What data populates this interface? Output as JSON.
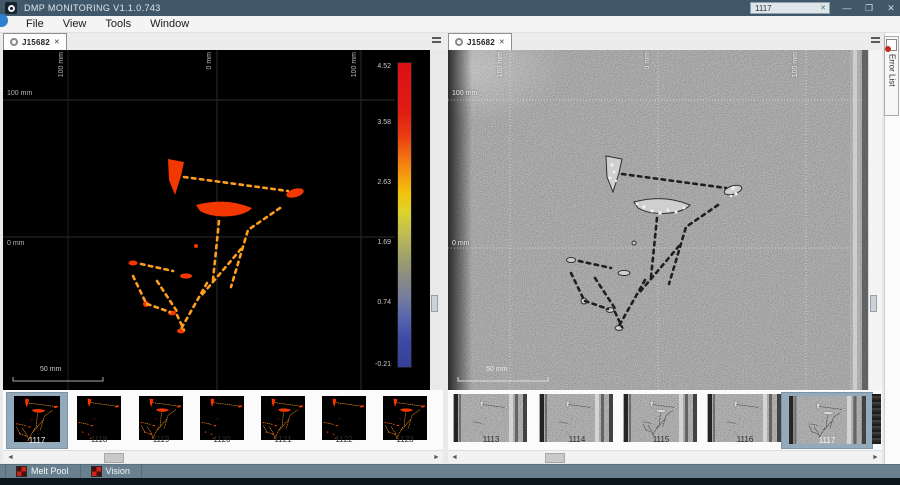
{
  "titlebar": {
    "title": "DMP MONITORING V1.1.0.743",
    "search_value": "1117"
  },
  "icons": {
    "minimize": "—",
    "restore": "❐",
    "close": "✕",
    "clear": "✕",
    "tab_close": "✕",
    "arrow_left": "◄",
    "arrow_right": "►"
  },
  "menubar": {
    "items": [
      "File",
      "View",
      "Tools",
      "Window"
    ]
  },
  "melt_pool_panel": {
    "tab_label": "J15682",
    "axis_top": [
      "100 mm",
      "0 mm",
      "100 mm"
    ],
    "axis_left_top": "100 mm",
    "axis_left_mid": "0 mm",
    "scale_label": "50 mm",
    "colorbar": {
      "labels": [
        "4.52",
        "3.58",
        "2.63",
        "1.69",
        "0.74",
        "-0.21"
      ]
    },
    "thumbnails": [
      {
        "label": "1117",
        "selected": true
      },
      {
        "label": "1118",
        "selected": false
      },
      {
        "label": "1119",
        "selected": false
      },
      {
        "label": "1120",
        "selected": false
      },
      {
        "label": "1121",
        "selected": false
      },
      {
        "label": "1122",
        "selected": false
      },
      {
        "label": "1123",
        "selected": false
      }
    ]
  },
  "vision_panel": {
    "tab_label": "J15682",
    "axis_top": [
      "100 mm",
      "0 mm",
      "100 mm"
    ],
    "axis_left_top": "100 mm",
    "axis_left_mid": "0 mm",
    "scale_label": "50 mm",
    "thumbnails": [
      {
        "label": "1113",
        "selected": false
      },
      {
        "label": "1114",
        "selected": false
      },
      {
        "label": "1115",
        "selected": false
      },
      {
        "label": "1116",
        "selected": false
      },
      {
        "label": "1117",
        "selected": true
      }
    ]
  },
  "error_list": {
    "label": "Error List"
  },
  "statusbar": {
    "tabs": [
      "Melt Pool",
      "Vision"
    ]
  },
  "colors": {
    "titlebar": "#41586a",
    "selection": "#93a9bc",
    "melt_pool_orange": "#f23800",
    "melt_pool_dash": "#ff9e1e",
    "error_red": "#c42b1c"
  }
}
